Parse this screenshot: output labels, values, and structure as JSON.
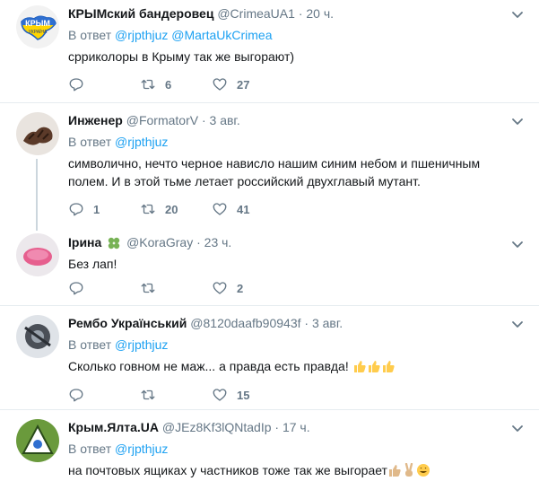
{
  "reply_prefix": "В ответ",
  "tweets": [
    {
      "name": "КРЫМский бандеровец",
      "handle": "@CrimeaUA1",
      "dot": "·",
      "time": "20 ч.",
      "mentions": [
        "@rjpthjuz",
        "@MartaUkCrimea"
      ],
      "text": "срриколоры в Крыму так же выгорают)",
      "reply_count": "",
      "retweet_count": "6",
      "like_count": "27",
      "avatar_text": "КРЫМ",
      "avatar_subtext": "УКРАЇНА"
    },
    {
      "name": "Инженер",
      "handle": "@FormatorV",
      "dot": "·",
      "time": "3 авг.",
      "mentions": [
        "@rjpthjuz"
      ],
      "text": "символично, нечто черное нависло нашим синим небом и пшеничным полем. И в этой тьме летает российский двухглавый мутант.",
      "reply_count": "1",
      "retweet_count": "20",
      "like_count": "41"
    },
    {
      "name": "Ірина",
      "handle": "@KoraGray",
      "dot": "·",
      "time": "23 ч.",
      "text": "Без лап!",
      "reply_count": "",
      "retweet_count": "",
      "like_count": "2"
    },
    {
      "name": "Рембо Український",
      "handle": "@8120daafb90943f",
      "dot": "·",
      "time": "3 авг.",
      "mentions": [
        "@rjpthjuz"
      ],
      "text": "Сколько говном не маж... а правда есть правда!",
      "reply_count": "",
      "retweet_count": "",
      "like_count": "15"
    },
    {
      "name": "Крым.Ялта.UA",
      "handle": "@JEz8Kf3lQNtadIp",
      "dot": "·",
      "time": "17 ч.",
      "mentions": [
        "@rjpthjuz"
      ],
      "text": "на почтовых ящиках у частников тоже так же выгорает"
    }
  ],
  "colors": {
    "accent": "#1da1f2",
    "muted": "#657786",
    "divider": "#e6ecf0",
    "thread": "#ccd6dd",
    "clover": "#77b255",
    "thumb": "#ffcc4d"
  },
  "icons": [
    "chevron-down-icon",
    "reply-icon",
    "retweet-icon",
    "like-icon",
    "clover-icon",
    "thumbs-up-icon",
    "victory-hand-icon",
    "grin-icon"
  ]
}
